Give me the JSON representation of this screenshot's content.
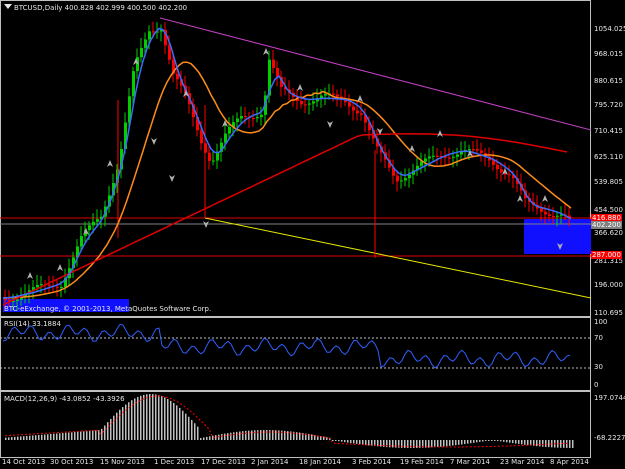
{
  "main": {
    "header": "BTCUSD,Daily  400.828 402.999 400.500 402.200",
    "footer": "BTC-eExchange, © 2001-2013, MetaQuotes Software Corp.",
    "price_labels": [
      "1054.025",
      "968.015",
      "880.615",
      "795.720",
      "710.415",
      "625.110",
      "539.805",
      "454.500",
      "366.620",
      "281.315",
      "196.000",
      "110.695"
    ],
    "level_tags": [
      "416.880",
      "402.200",
      "287.000"
    ]
  },
  "rsi": {
    "header": "RSI(14) 33.1884",
    "labels": [
      "100",
      "70",
      "30",
      "0"
    ]
  },
  "macd": {
    "header": "MACD(12,26,9) -43.0852 -43.3926",
    "labels": [
      "197.0744",
      "-68.2227"
    ]
  },
  "time_labels": [
    "14 Oct 2013",
    "30 Oct 2013",
    "15 Nov 2013",
    "1 Dec 2013",
    "17 Dec 2013",
    "2 Jan 2014",
    "18 Jan 2014",
    "3 Feb 2014",
    "19 Feb 2014",
    "7 Mar 2014",
    "23 Mar 2014",
    "8 Apr 2014"
  ],
  "colors": {
    "bull": "#00d000",
    "bear": "#ff0000",
    "ma_fast": "#ff8c1a",
    "ma_slow": "#e00000",
    "ma_blue": "#3b6bff",
    "trend_down": "#c040c0",
    "trend_support": "#e8e800",
    "zone": "#1010ff",
    "rsi_line": "#3060ff",
    "macd_signal": "#ff0000",
    "macd_hist": "#c0c0c0"
  },
  "chart_data": [
    {
      "type": "candlestick",
      "title": "BTCUSD,Daily",
      "ohlc_last": {
        "open": 400.828,
        "high": 402.999,
        "low": 400.5,
        "close": 402.2
      },
      "ylim": [
        110.695,
        1100
      ],
      "x": [
        "14 Oct 2013",
        "30 Oct 2013",
        "15 Nov 2013",
        "1 Dec 2013",
        "17 Dec 2013",
        "2 Jan 2014",
        "18 Jan 2014",
        "3 Feb 2014",
        "19 Feb 2014",
        "7 Mar 2014",
        "23 Mar 2014",
        "8 Apr 2014"
      ],
      "close": [
        140,
        200,
        420,
        1050,
        700,
        850,
        830,
        810,
        600,
        640,
        520,
        402.2
      ],
      "horizontal_levels": [
        416.88,
        402.2,
        287.0
      ],
      "grid": false,
      "legend": "none"
    },
    {
      "type": "line",
      "title": "RSI(14)",
      "ylim": [
        0,
        100
      ],
      "levels": [
        70,
        30
      ],
      "last_value": 33.1884
    },
    {
      "type": "bar",
      "title": "MACD(12,26,9)",
      "ylim": [
        -68.2227,
        197.0744
      ],
      "last_values": {
        "macd": -43.0852,
        "signal": -43.3926
      }
    }
  ]
}
